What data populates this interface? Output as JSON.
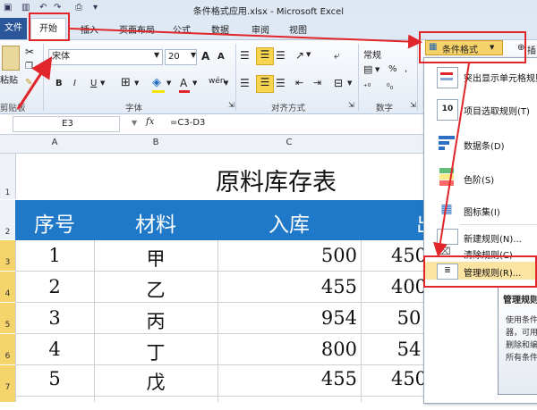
{
  "window": {
    "title": "条件格式应用.xlsx - Microsoft Excel"
  },
  "tabs": [
    "文件",
    "开始",
    "插入",
    "页面布局",
    "公式",
    "数据",
    "审阅",
    "视图"
  ],
  "ribbon": {
    "paste_label": "粘贴",
    "clipboard_label": "剪贴板",
    "font_name": "宋体",
    "font_size": "20",
    "grow_font": "A",
    "shrink_font": "A",
    "bold": "B",
    "italic": "I",
    "underline": "U",
    "font_color_btn": "A",
    "phonetic_btn": "wén",
    "font_group_label": "字体",
    "align_group_label": "对齐方式",
    "number_format": "常规",
    "percent": "%",
    "comma": ",",
    "number_group_label": "数字",
    "cond_format_button": "条件格式",
    "insert_partial": "插"
  },
  "formula_bar": {
    "name_box": "E3",
    "fx": "fx",
    "formula": "=C3-D3"
  },
  "columns": [
    "A",
    "B",
    "C"
  ],
  "rows": [
    "1",
    "2",
    "3",
    "4",
    "5",
    "6",
    "7"
  ],
  "sheet": {
    "title": "原料库存表",
    "headers": [
      "序号",
      "材料",
      "入库",
      "出"
    ],
    "data": [
      [
        "1",
        "甲",
        "500",
        "450"
      ],
      [
        "2",
        "乙",
        "455",
        "400"
      ],
      [
        "3",
        "丙",
        "954",
        "50"
      ],
      [
        "4",
        "丁",
        "800",
        "54"
      ],
      [
        "5",
        "戊",
        "455",
        "450"
      ]
    ]
  },
  "cf_menu": {
    "items": [
      "突出显示单元格规则(H)",
      "项目选取规则(T)",
      "数据条(D)",
      "色阶(S)",
      "图标集(I)",
      "新建规则(N)...",
      "清除规则(C)",
      "管理规则(R)..."
    ]
  },
  "tooltip": {
    "title": "管理规则",
    "lines": [
      "使用条件",
      "器，可用",
      "删除和编",
      "所有条件"
    ]
  },
  "colors": {
    "accent_blue": "#1f78c8",
    "highlight_red": "#e0262a",
    "file_tab": "#2b579a",
    "row_header_selected": "#f5d46b"
  }
}
